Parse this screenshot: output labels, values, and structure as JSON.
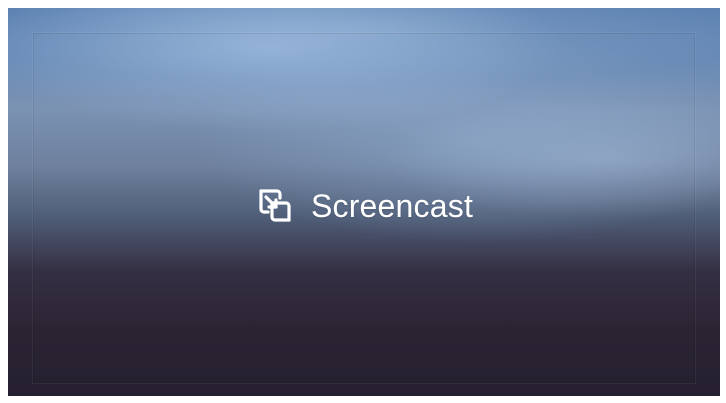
{
  "screen": {
    "title": "Screencast",
    "icon": "screencast-icon"
  },
  "colors": {
    "text": "#ffffff",
    "top_blue": "#6a8bb6",
    "bottom_dark": "#252030"
  }
}
